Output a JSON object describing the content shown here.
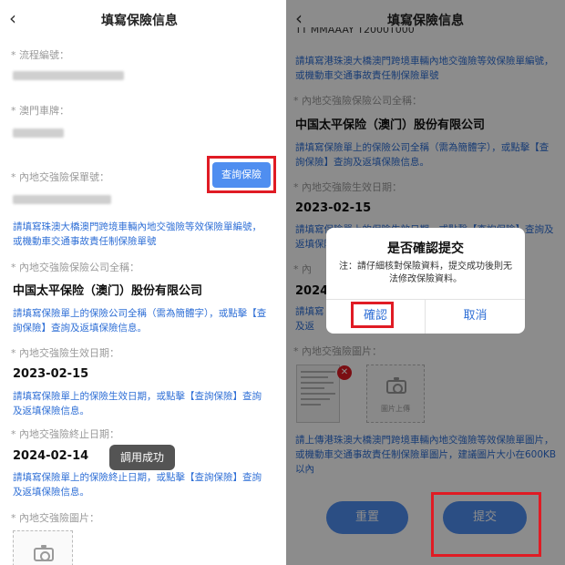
{
  "left": {
    "title": "填寫保險信息",
    "back_icon": "‹",
    "labels": {
      "flow_no": "* 流程編號：",
      "macau_plate": "* 澳門車牌：",
      "policy_no": "* 內地交強險保單號：",
      "company": "* 內地交強險保險公司全稱：",
      "effective": "* 內地交強險生效日期：",
      "expiry": "* 內地交強險終止日期：",
      "image": "* 內地交強險圖片："
    },
    "query_button": "查詢保險",
    "hint_policy": "請填寫珠澳大橋澳門跨境車輛內地交強險等效保險單編號，或機動車交通事故責任制保險單號",
    "company_value": "中国太平保险（澳门）股份有限公司",
    "hint_company": "請填寫保險單上的保險公司全稱（需為簡體字），或點擊【查詢保險】查詢及返填保險信息。",
    "effective_value": "2023-02-15",
    "hint_effective": "請填寫保險單上的保險生效日期，或點擊【查詢保險】查詢及返填保險信息。",
    "expiry_value": "2024-02-14",
    "hint_expiry": "請填寫保險單上的保險終止日期，或點擊【查詢保險】查詢及返填保險信息。",
    "toast": "調用成功"
  },
  "right": {
    "title": "填寫保險信息",
    "back_icon": "‹",
    "top_cut": "TT MMAAAY T2000T000",
    "hint_policy": "請填寫港珠澳大橋澳門跨境車輛內地交強險等效保險單編號，或機動車交通事故責任制保險單號",
    "label_company": "* 內地交強險保險公司全稱：",
    "company_value": "中国太平保险（澳门）股份有限公司",
    "hint_company": "請填寫保險單上的保險公司全稱（需為簡體字），或點擊【查詢保險】查詢及返填保險信息。",
    "label_effective": "* 內地交強險生效日期：",
    "effective_value": "2023-02-15",
    "hint_effective_partial": "請填寫保險單上的保險生效日期，或點擊【查詢保險】查詢及返填保險信息。",
    "label_expiry_partial": "* 內",
    "expiry_partial": "2024-",
    "hint_expiry_partial": "請填寫及返",
    "label_image": "* 內地交強險圖片：",
    "upload_text": "圖片上傳",
    "delete_icon": "✕",
    "hint_image": "請上傳港珠澳大橋澳門跨境車輛內地交強險等效保險單圖片，或機動車交通事故責任制保險單圖片，建議圖片大小在600KB以內",
    "reset_button": "重置",
    "submit_button": "提交",
    "dialog": {
      "title": "是否確認提交",
      "message": "注：請仔細核對保險資料，提交成功後則无法修改保險資料。",
      "confirm": "確認",
      "cancel": "取消"
    }
  },
  "colors": {
    "accent": "#4f8ef0",
    "link": "#2f6fd6",
    "highlight": "#e01b24"
  }
}
